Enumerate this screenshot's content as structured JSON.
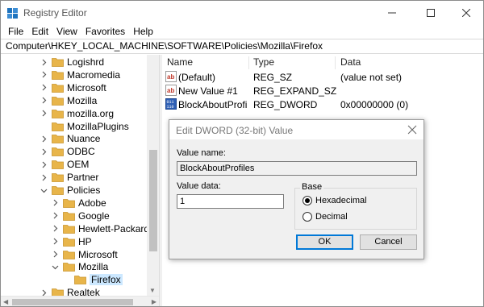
{
  "window": {
    "title": "Registry Editor"
  },
  "menu": [
    "File",
    "Edit",
    "View",
    "Favorites",
    "Help"
  ],
  "address": "Computer\\HKEY_LOCAL_MACHINE\\SOFTWARE\\Policies\\Mozilla\\Firefox",
  "tree": [
    {
      "label": "Logishrd",
      "expanded": false
    },
    {
      "label": "Macromedia",
      "expanded": false
    },
    {
      "label": "Microsoft",
      "expanded": false
    },
    {
      "label": "Mozilla",
      "expanded": false
    },
    {
      "label": "mozilla.org",
      "expanded": false
    },
    {
      "label": "MozillaPlugins",
      "expanded": null
    },
    {
      "label": "Nuance",
      "expanded": false
    },
    {
      "label": "ODBC",
      "expanded": false
    },
    {
      "label": "OEM",
      "expanded": false
    },
    {
      "label": "Partner",
      "expanded": false
    },
    {
      "label": "Policies",
      "expanded": true
    },
    {
      "label": "Adobe",
      "expanded": false
    },
    {
      "label": "Google",
      "expanded": false
    },
    {
      "label": "Hewlett-Packard",
      "expanded": false
    },
    {
      "label": "HP",
      "expanded": false
    },
    {
      "label": "Microsoft",
      "expanded": false
    },
    {
      "label": "Mozilla",
      "expanded": true
    },
    {
      "label": "Firefox",
      "expanded": null,
      "selected": true
    },
    {
      "label": "Realtek",
      "expanded": false
    }
  ],
  "columns": {
    "name": "Name",
    "type": "Type",
    "data": "Data"
  },
  "values": [
    {
      "name": "(Default)",
      "type": "REG_SZ",
      "data": "(value not set)",
      "icon": "string-value-icon"
    },
    {
      "name": "New Value #1",
      "type": "REG_EXPAND_SZ",
      "data": "",
      "icon": "string-value-icon"
    },
    {
      "name": "BlockAboutProfil...",
      "type": "REG_DWORD",
      "data": "0x00000000 (0)",
      "icon": "binary-value-icon"
    }
  ],
  "dialog": {
    "title": "Edit DWORD (32-bit) Value",
    "value_name_label": "Value name:",
    "value_name": "BlockAboutProfiles",
    "value_data_label": "Value data:",
    "value_data": "1",
    "base_label": "Base",
    "base_options": [
      {
        "label": "Hexadecimal",
        "checked": true
      },
      {
        "label": "Decimal",
        "checked": false
      }
    ],
    "ok_label": "OK",
    "cancel_label": "Cancel"
  },
  "colors": {
    "folder": "#e8b54a",
    "selection": "#cce8ff",
    "string_icon": "#c0392b",
    "binary_icon": "#2e5fb5",
    "app_icon": "#1e73be"
  }
}
